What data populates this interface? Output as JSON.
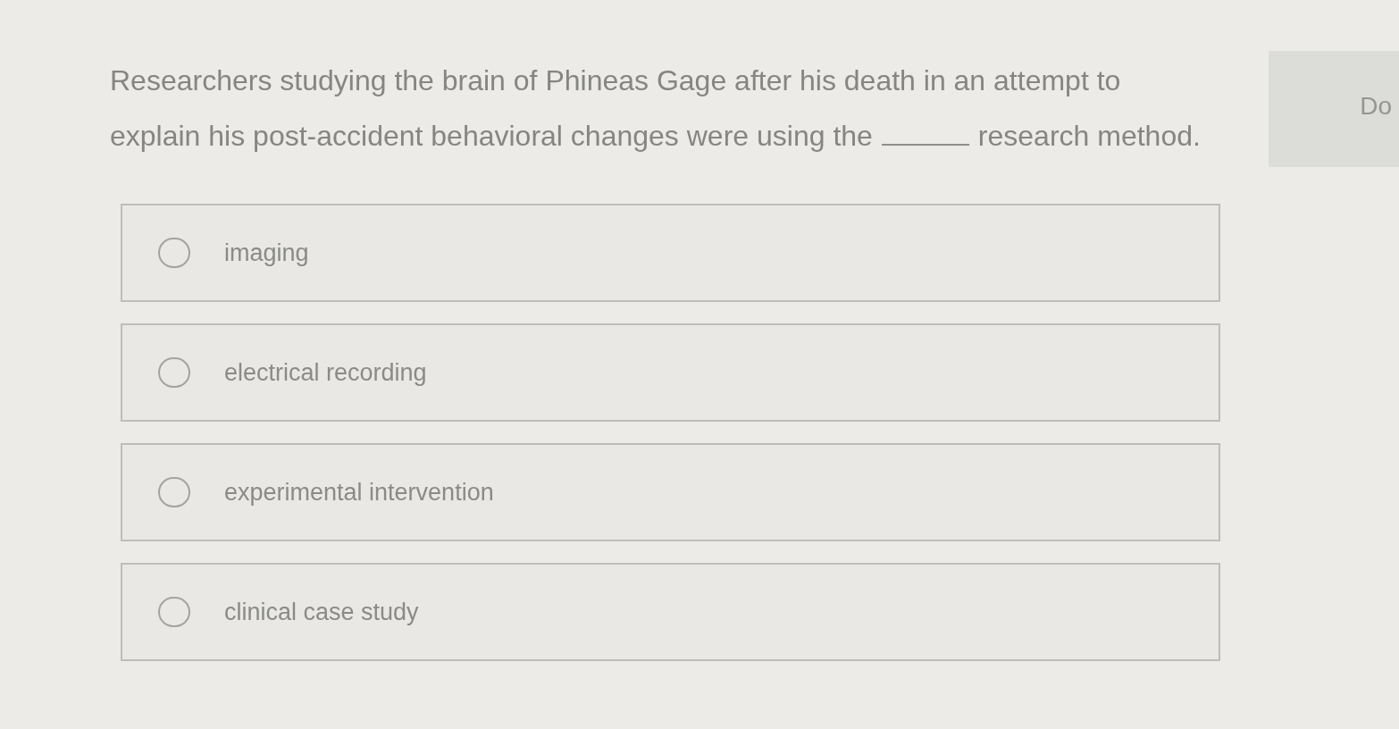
{
  "question": {
    "lines_before": [
      "Researchers studying the brain of Phineas Gage after his death in an attempt to",
      "explain his post-accident behavioral changes were using the"
    ],
    "blank": {
      "kind": "fill-in-line"
    },
    "text_after": "research method."
  },
  "side_button": {
    "label": "Do"
  },
  "options": [
    {
      "label": "imaging",
      "selected": false
    },
    {
      "label": "electrical recording",
      "selected": false
    },
    {
      "label": "experimental intervention",
      "selected": false
    },
    {
      "label": "clinical case study",
      "selected": false
    }
  ]
}
